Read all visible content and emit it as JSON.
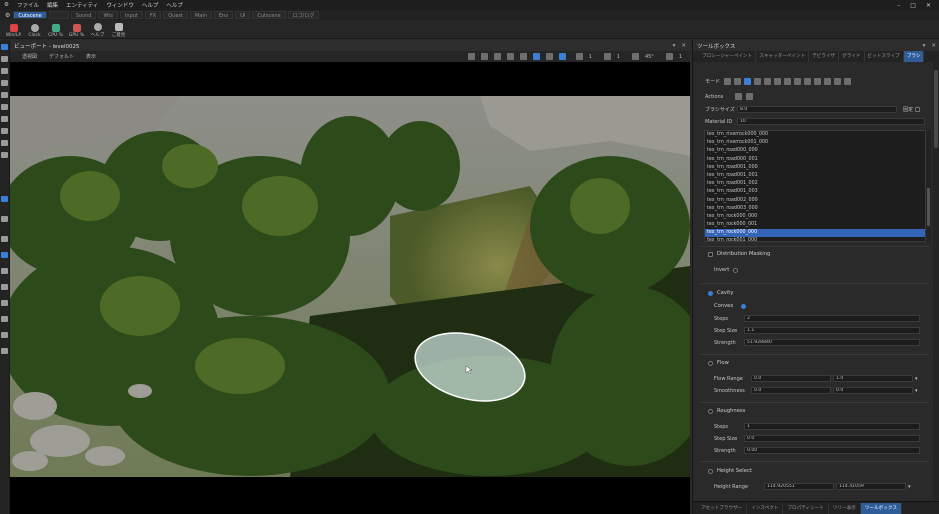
{
  "menu": [
    "ファイル",
    "編集",
    "エンティティ",
    "ウィンドウ",
    "ヘルプ",
    "ヘルプ"
  ],
  "workspace_tabs": [
    "Cutscene",
    "",
    "Sound",
    "Wts",
    "Input",
    "FX",
    "Quest",
    "Main",
    "Env",
    "UI",
    "Cutscene",
    "ロゴ/ログ"
  ],
  "workspace_active": 0,
  "toolbar": [
    {
      "label": "Win/LP",
      "color": "#d44"
    },
    {
      "label": "Clock",
      "color": "#aaa"
    },
    {
      "label": "CPU %",
      "color": "#4a8"
    },
    {
      "label": "GPU %",
      "color": "#c55"
    },
    {
      "label": "ヘルプ",
      "color": "#aaa"
    },
    {
      "label": "ご意見",
      "color": "#bbb"
    }
  ],
  "viewport": {
    "title": "ビューポート - level0025",
    "menu": [
      "透視図",
      "デフォルト",
      "表示"
    ],
    "readouts": [
      "1",
      "1",
      "45°",
      "1"
    ]
  },
  "toolbox": {
    "title": "ツールボックス",
    "tabs": [
      "プロシージャーペイント",
      "スキャッターペイント",
      "デビライザ",
      "グライド",
      "ビットスライプ",
      "ブラシ"
    ],
    "active_tab": 5,
    "mode_label": "モード",
    "actions_label": "Actions",
    "brush_size_label": "ブラシサイズ",
    "brush_size_value": "8.0",
    "lock_label": "固定",
    "material_id_label": "Material ID",
    "material_id_value": "10",
    "textures": [
      "tex_trn_riverrock000_000",
      "tex_trn_riverrock001_000",
      "tex_trn_road000_000",
      "tex_trn_road000_001",
      "tex_trn_road001_000",
      "tex_trn_road001_001",
      "tex_trn_road001_002",
      "tex_trn_road001_003",
      "tex_trn_road002_000",
      "tex_trn_road003_000",
      "tex_trn_rock000_000",
      "tex_trn_rock000_001",
      "tex_trn_rock000_000",
      "tex_trn_rock001_000"
    ],
    "selected_texture": 12,
    "distribution_masking": "Distribution Masking",
    "invert": "Invert",
    "cavity": "Cavity",
    "convex": "Convex",
    "cavity_steps_label": "Steps",
    "cavity_steps": "2",
    "cavity_step_size_label": "Step Size",
    "cavity_step_size": "1.1",
    "cavity_strength_label": "Strength",
    "cavity_strength": "51.928840",
    "flow": "Flow",
    "flow_range_label": "Flow Range",
    "flow_range_a": "0.0",
    "flow_range_b": "1.0",
    "smoothness_label": "Smoothness",
    "smoothness_a": "0.0",
    "smoothness_b": "0.0",
    "roughness": "Roughness",
    "rough_steps_label": "Steps",
    "rough_steps": "1",
    "rough_step_size_label": "Step Size",
    "rough_step_size": "0.0",
    "rough_strength_label": "Strength",
    "rough_strength": "0.00",
    "height_select": "Height Select",
    "height_range_label": "Height Range",
    "height_range_a": "114.920551",
    "height_range_b": "114.41059"
  },
  "bottom_tabs": [
    "アセットブラウザー",
    "インスペクト",
    "プロパティシート",
    "ツリー表示",
    "ツールボックス"
  ],
  "bottom_active": 4
}
